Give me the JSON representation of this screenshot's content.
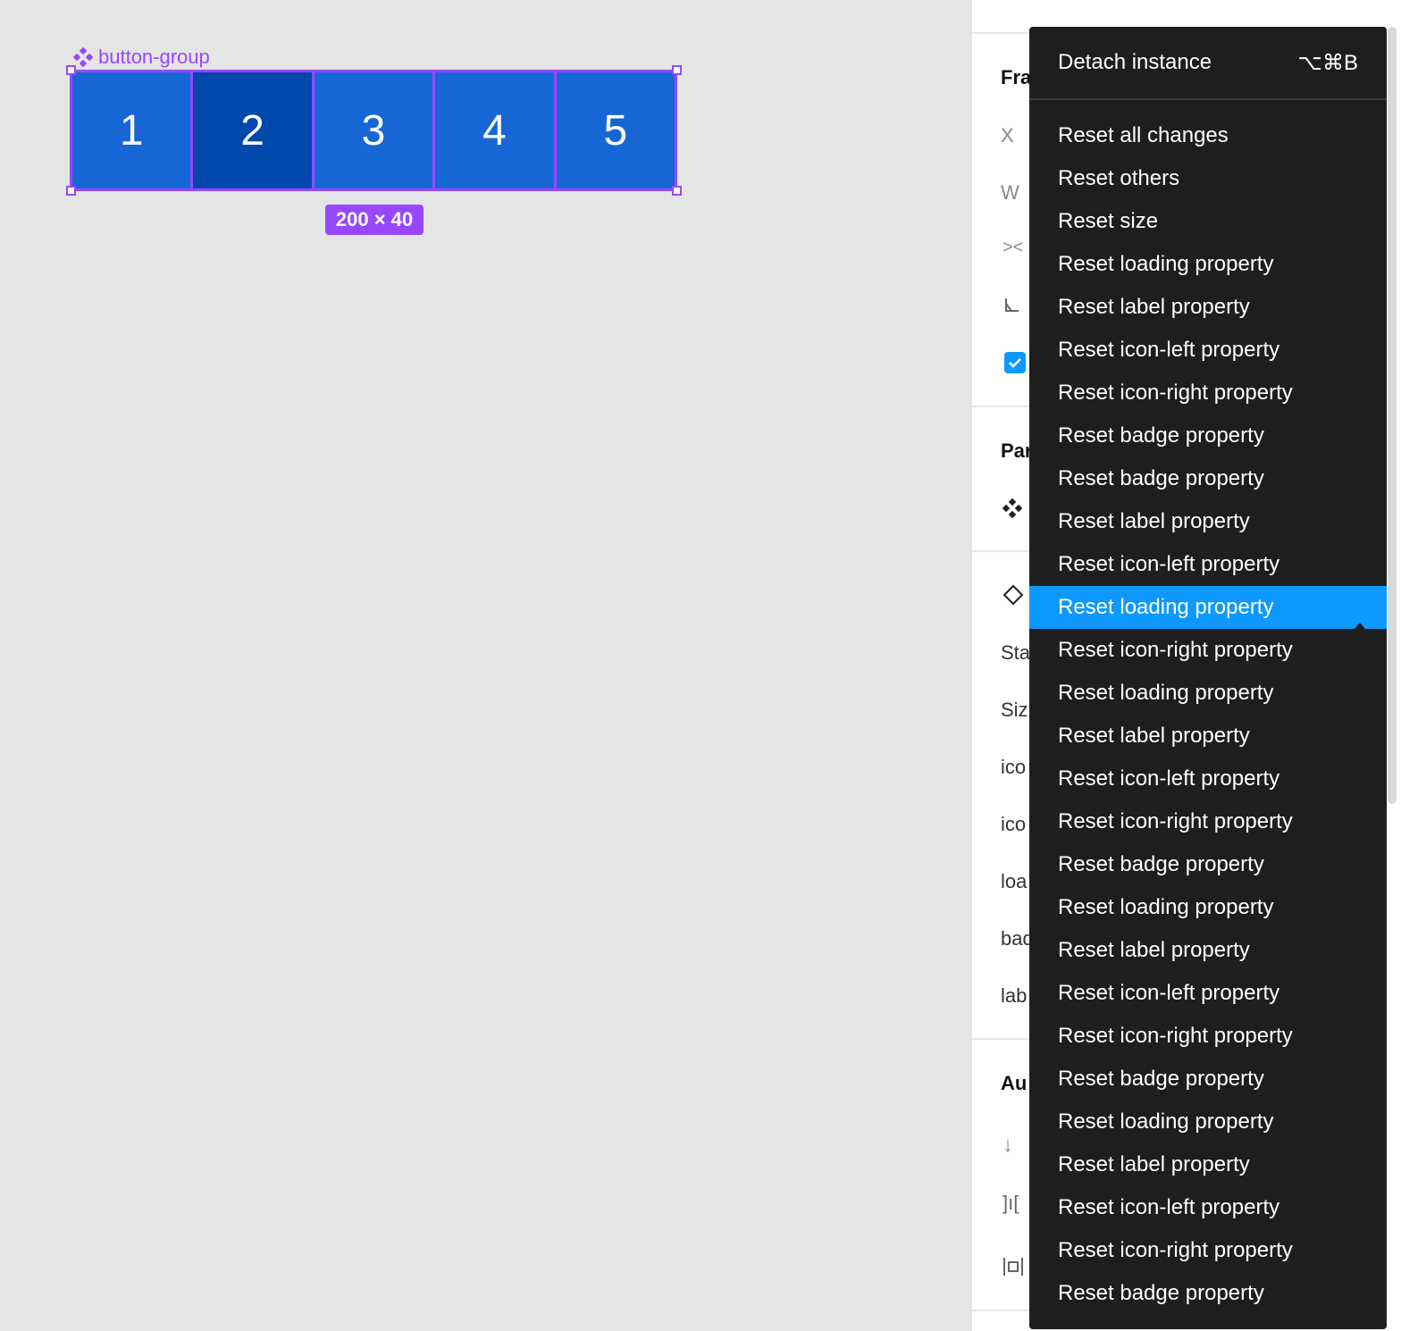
{
  "canvas": {
    "frame_label": "button-group",
    "buttons": [
      {
        "label": "1",
        "active": false
      },
      {
        "label": "2",
        "active": true
      },
      {
        "label": "3",
        "active": false
      },
      {
        "label": "4",
        "active": false
      },
      {
        "label": "5",
        "active": false
      }
    ],
    "size_badge": "200 × 40",
    "accent_color": "#9747ff",
    "button_color": "#1766d6",
    "button_active_color": "#0148ad"
  },
  "panel": {
    "labels": {
      "frame": "Fra",
      "x": "X",
      "w": "W",
      "parent": "Par",
      "state": "Sta",
      "size": "Siz",
      "icon1": "ico",
      "icon2": "ico",
      "loading": "loa",
      "badge": "bad",
      "label": "lab",
      "autolayout": "Au"
    }
  },
  "menu": {
    "header": {
      "label": "Detach instance",
      "shortcut": "⌥⌘B"
    },
    "highlight_color": "#0d99ff",
    "items": [
      "Reset all changes",
      "Reset others",
      "Reset size",
      "Reset loading property",
      "Reset label property",
      "Reset icon-left property",
      "Reset icon-right property",
      "Reset badge property",
      "Reset badge property",
      "Reset label property",
      "Reset icon-left property",
      "Reset loading property",
      "Reset icon-right property",
      "Reset loading property",
      "Reset label property",
      "Reset icon-left property",
      "Reset icon-right property",
      "Reset badge property",
      "Reset loading property",
      "Reset label property",
      "Reset icon-left property",
      "Reset icon-right property",
      "Reset badge property",
      "Reset loading property",
      "Reset label property",
      "Reset icon-left property",
      "Reset icon-right property",
      "Reset badge property"
    ],
    "highlighted_index": 11
  }
}
